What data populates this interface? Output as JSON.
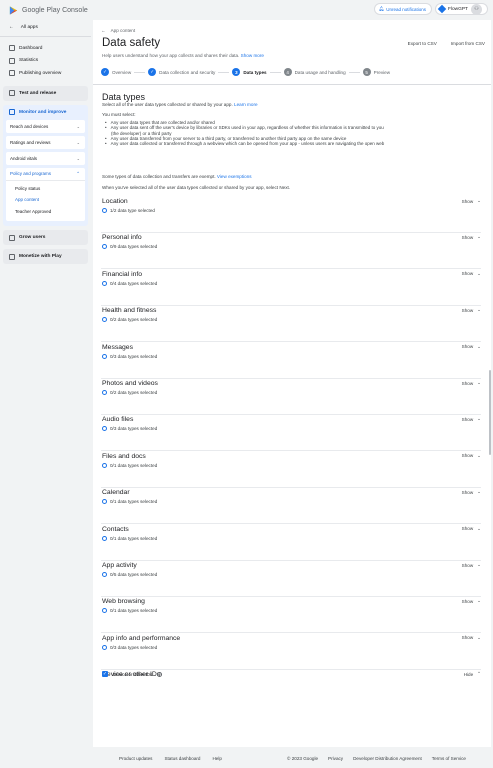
{
  "app": {
    "logo_text": "Google Play",
    "logo_sub": "Console",
    "notifications_label": "Unread notifications",
    "account_name": "FlowGPT"
  },
  "sidebar": {
    "back_label": "All apps",
    "items": [
      {
        "label": "Dashboard",
        "icon": "dashboard-icon"
      },
      {
        "label": "Statistics",
        "icon": "statistics-icon"
      },
      {
        "label": "Publishing overview",
        "icon": "publishing-icon"
      }
    ],
    "test_release": "Test and release",
    "monitor": "Monitor and improve",
    "monitor_items": [
      {
        "label": "Reach and devices"
      },
      {
        "label": "Ratings and reviews"
      },
      {
        "label": "Android vitals"
      }
    ],
    "policy": {
      "label": "Policy and programs",
      "sub": [
        "Policy status",
        "App content",
        "Teacher Approved"
      ]
    },
    "grow_users": "Grow users",
    "monetize": "Monetize with Play"
  },
  "main": {
    "breadcrumb": "App content",
    "title": "Data safety",
    "description": "Help users understand how your app collects and shares their data.",
    "show_more": "Show more",
    "export_label": "Export to CSV",
    "import_label": "Import from CSV",
    "steps": [
      {
        "num": "✓",
        "label": "Overview",
        "state": "done"
      },
      {
        "num": "✓",
        "label": "Data collection and security",
        "state": "done"
      },
      {
        "num": "3",
        "label": "Data types",
        "state": "cur"
      },
      {
        "num": "4",
        "label": "Data usage and handling",
        "state": "todo"
      },
      {
        "num": "5",
        "label": "Preview",
        "state": "todo"
      }
    ],
    "section_title": "Data types",
    "section_desc": "Select all of the user data types collected or shared by your app.",
    "learn_more": "Learn more",
    "must_select": "You must select:",
    "bullets": [
      "Any user data types that are collected and/or shared",
      "Any user data sent off the user's device by libraries or SDKs used in your app, regardless of whether this information is transmitted to you",
      "(the developer) or a third party",
      "Any user data transferred from your server to a third party, or transferred to another third party app on the same device",
      "Any user data collected or transferred through a webview which can be opened from your app - unless users are navigating the open web"
    ],
    "exempt_text": "Some types of data collection and transfers are exempt.",
    "view_exemptions": "View exemptions",
    "when_done": "When you've selected all of the user data types collected or shared by your app, select Next."
  },
  "categories": [
    {
      "name": "Location",
      "status": "1/2 data type selected",
      "toggle": "Show"
    },
    {
      "name": "Personal info",
      "status": "0/9 data types selected",
      "toggle": "Show"
    },
    {
      "name": "Financial info",
      "status": "0/4 data types selected",
      "toggle": "Show"
    },
    {
      "name": "Health and fitness",
      "status": "0/2 data types selected",
      "toggle": "Show"
    },
    {
      "name": "Messages",
      "status": "0/3 data types selected",
      "toggle": "Show"
    },
    {
      "name": "Photos and videos",
      "status": "0/2 data types selected",
      "toggle": "Show"
    },
    {
      "name": "Audio files",
      "status": "0/3 data types selected",
      "toggle": "Show"
    },
    {
      "name": "Files and docs",
      "status": "0/1 data types selected",
      "toggle": "Show"
    },
    {
      "name": "Calendar",
      "status": "0/1 data types selected",
      "toggle": "Show"
    },
    {
      "name": "Contacts",
      "status": "0/1 data types selected",
      "toggle": "Show"
    },
    {
      "name": "App activity",
      "status": "0/5 data types selected",
      "toggle": "Show"
    },
    {
      "name": "Web browsing",
      "status": "0/1 data types selected",
      "toggle": "Show"
    },
    {
      "name": "App info and performance",
      "status": "0/3 data types selected",
      "toggle": "Show"
    },
    {
      "name": "Device or other IDs",
      "status": "",
      "toggle": "Hide"
    }
  ],
  "device_ids_checkbox": "Device or other IDs",
  "footer": {
    "links_left": [
      "Product updates",
      "Status dashboard",
      "Help"
    ],
    "copyright": "© 2023 Google",
    "links_right": [
      "Privacy",
      "Developer Distribution Agreement",
      "Terms of Service"
    ]
  }
}
